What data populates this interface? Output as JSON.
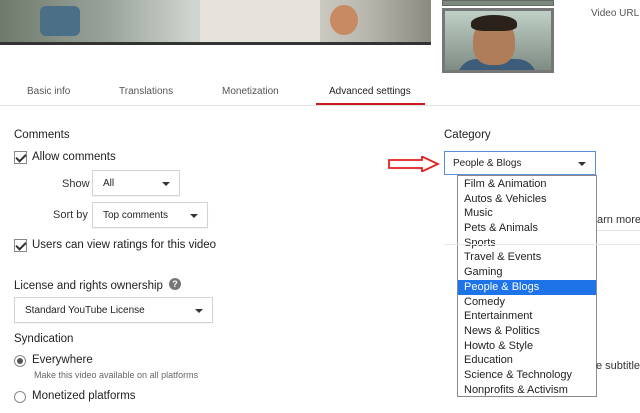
{
  "header": {
    "video_url_label": "Video URL:"
  },
  "tabs": [
    {
      "label": "Basic info"
    },
    {
      "label": "Translations"
    },
    {
      "label": "Monetization"
    },
    {
      "label": "Advanced settings",
      "active": true
    }
  ],
  "comments": {
    "title": "Comments",
    "allow_comments": {
      "label": "Allow comments",
      "checked": true
    },
    "show": {
      "label": "Show",
      "value": "All"
    },
    "sort_by": {
      "label": "Sort by",
      "value": "Top comments"
    },
    "ratings": {
      "label": "Users can view ratings for this video",
      "checked": true
    }
  },
  "license": {
    "title": "License and rights ownership",
    "help_icon": "question-icon",
    "value": "Standard YouTube License"
  },
  "syndication": {
    "title": "Syndication",
    "options": [
      {
        "label": "Everywhere",
        "sub": "Make this video available on all platforms",
        "selected": true
      },
      {
        "label": "Monetized platforms",
        "selected": false
      }
    ]
  },
  "category": {
    "title": "Category",
    "selected": "People & Blogs",
    "options": [
      "Film & Animation",
      "Autos & Vehicles",
      "Music",
      "Pets & Animals",
      "Sports",
      "Travel & Events",
      "Gaming",
      "People & Blogs",
      "Comedy",
      "Entertainment",
      "News & Politics",
      "Howto & Style",
      "Education",
      "Science & Technology",
      "Nonprofits & Activism"
    ],
    "arrow_color": "#e32020",
    "highlight_color": "#1e73e8"
  },
  "right_fragments": {
    "learn_more": "arn more",
    "subtitles": "e subtitle"
  }
}
